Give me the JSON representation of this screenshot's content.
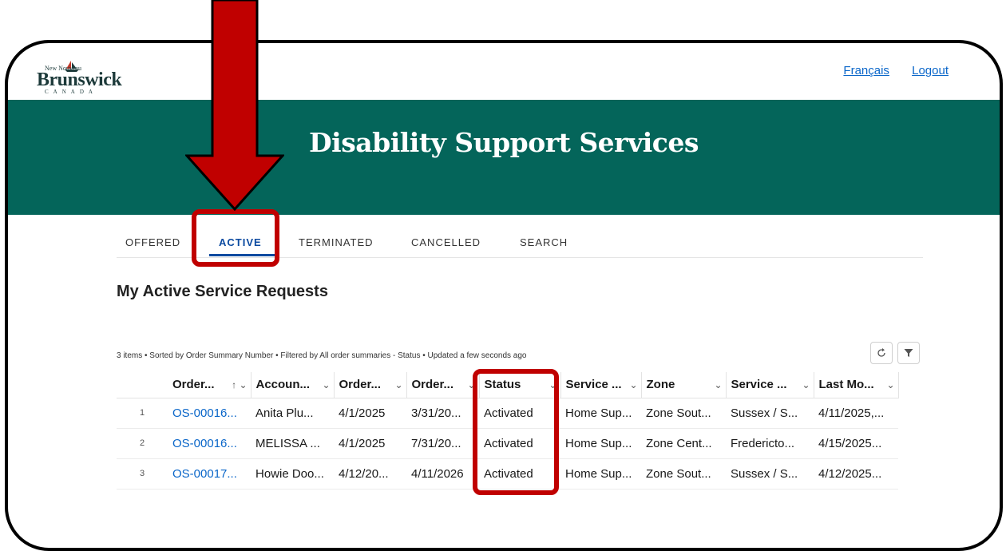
{
  "logo": {
    "top": "New  Nouveau",
    "main": "Brunswick",
    "country": "CANADA"
  },
  "header_links": {
    "language": "Français",
    "logout": "Logout"
  },
  "banner": {
    "title": "Disability Support Services"
  },
  "tabs": [
    {
      "label": "OFFERED",
      "active": false
    },
    {
      "label": "ACTIVE",
      "active": true
    },
    {
      "label": "TERMINATED",
      "active": false
    },
    {
      "label": "CANCELLED",
      "active": false
    },
    {
      "label": "SEARCH",
      "active": false
    }
  ],
  "section": {
    "title": "My Active Service Requests"
  },
  "list_meta": "3 items • Sorted by Order Summary Number • Filtered by All order summaries - Status • Updated a few seconds ago",
  "toolbar": {
    "refresh_icon": "refresh-icon",
    "filter_icon": "filter-icon"
  },
  "table": {
    "columns": [
      "Order...",
      "Accoun...",
      "Order...",
      "Order...",
      "Status",
      "Service ...",
      "Zone",
      "Service ...",
      "Last Mo..."
    ],
    "sort_indicator": "↑",
    "chevron": "⌄",
    "rows": [
      {
        "num": "1",
        "cells": [
          "OS-00016...",
          "Anita Plu...",
          "4/1/2025",
          "3/31/20...",
          "Activated",
          "Home Sup...",
          "Zone Sout...",
          "Sussex / S...",
          "4/11/2025,..."
        ]
      },
      {
        "num": "2",
        "cells": [
          "OS-00016...",
          "MELISSA ...",
          "4/1/2025",
          "7/31/20...",
          "Activated",
          "Home Sup...",
          "Zone Cent...",
          "Fredericto...",
          "4/15/2025..."
        ]
      },
      {
        "num": "3",
        "cells": [
          "OS-00017...",
          "Howie Doo...",
          "4/12/20...",
          "4/11/2026",
          "Activated",
          "Home Sup...",
          "Zone Sout...",
          "Sussex / S...",
          "4/12/2025..."
        ]
      }
    ]
  },
  "annotation_color": "#c00000",
  "brand_color": "#04655a"
}
